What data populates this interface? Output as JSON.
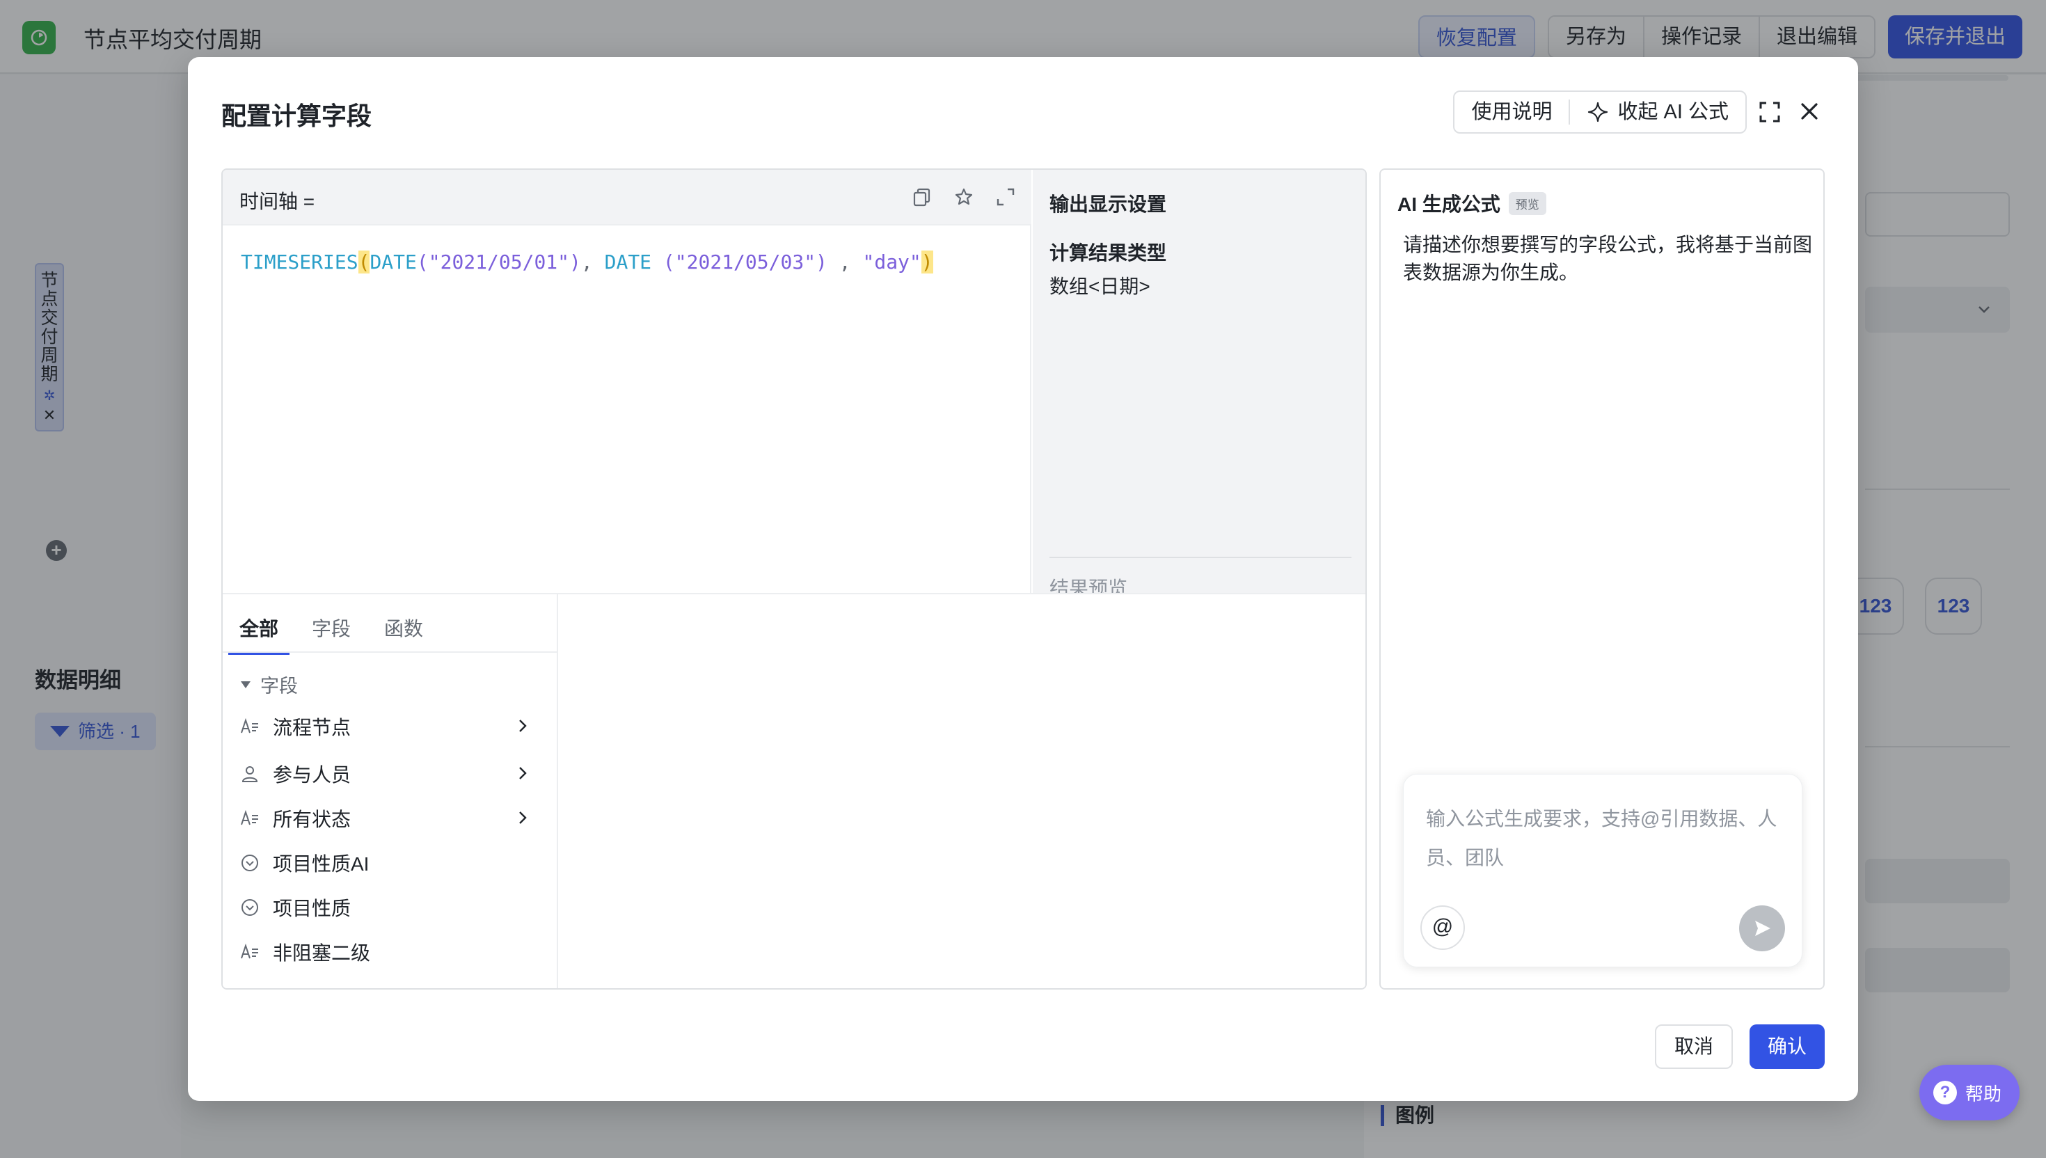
{
  "app": {
    "title": "节点平均交付周期",
    "top_actions": {
      "restore": "恢复配置",
      "save_as": "另存为",
      "history": "操作记录",
      "exit_edit": "退出编辑",
      "save_exit": "保存并退出"
    }
  },
  "background": {
    "vertical_tag": [
      "节",
      "点",
      "交",
      "付",
      "周",
      "期"
    ],
    "data_detail_heading": "数据明细",
    "filter_chip": "筛选 · 1",
    "badges": [
      "123",
      "123"
    ],
    "legend_heading": "图例"
  },
  "modal": {
    "title": "配置计算字段",
    "header_actions": {
      "guide": "使用说明",
      "collapse_ai": "收起 AI 公式"
    },
    "editor": {
      "label": "时间轴 =",
      "code": {
        "fn1": "TIMESERIES",
        "open": "(",
        "fn2": "DATE",
        "arg1": "(\"2021/05/01\")",
        "comma1": ", ",
        "fn3": "DATE",
        "arg2": " (\"2021/05/03\") ",
        "comma2": ", ",
        "arg3": "\"day\"",
        "close": ")"
      }
    },
    "output": {
      "title": "输出显示设置",
      "result_type_label": "计算结果类型",
      "result_type_value": "数组<日期>",
      "preview_label": "结果预览"
    },
    "tabs": [
      "全部",
      "字段",
      "函数"
    ],
    "field_group_label": "字段",
    "fields": [
      {
        "label": "流程节点",
        "icon": "text-field-icon",
        "has_children": true
      },
      {
        "label": "参与人员",
        "icon": "person-icon",
        "has_children": true
      },
      {
        "label": "所有状态",
        "icon": "text-field-icon",
        "has_children": true
      },
      {
        "label": "项目性质AI",
        "icon": "select-icon",
        "has_children": false
      },
      {
        "label": "项目性质",
        "icon": "select-icon",
        "has_children": false
      },
      {
        "label": "非阻塞二级",
        "icon": "text-field-icon",
        "has_children": false
      }
    ],
    "ai": {
      "title": "AI 生成公式",
      "badge": "预览",
      "description": "请描述你想要撰写的字段公式，我将基于当前图表数据源为你生成。",
      "input_placeholder": "输入公式生成要求，支持@引用数据、人员、团队",
      "at_symbol": "@"
    },
    "footer": {
      "cancel": "取消",
      "confirm": "确认"
    }
  },
  "help": {
    "label": "帮助"
  },
  "colors": {
    "accent": "#3253e4",
    "function": "#2b9fc9",
    "string": "#7b5fdb",
    "help": "#7c6cf0"
  }
}
